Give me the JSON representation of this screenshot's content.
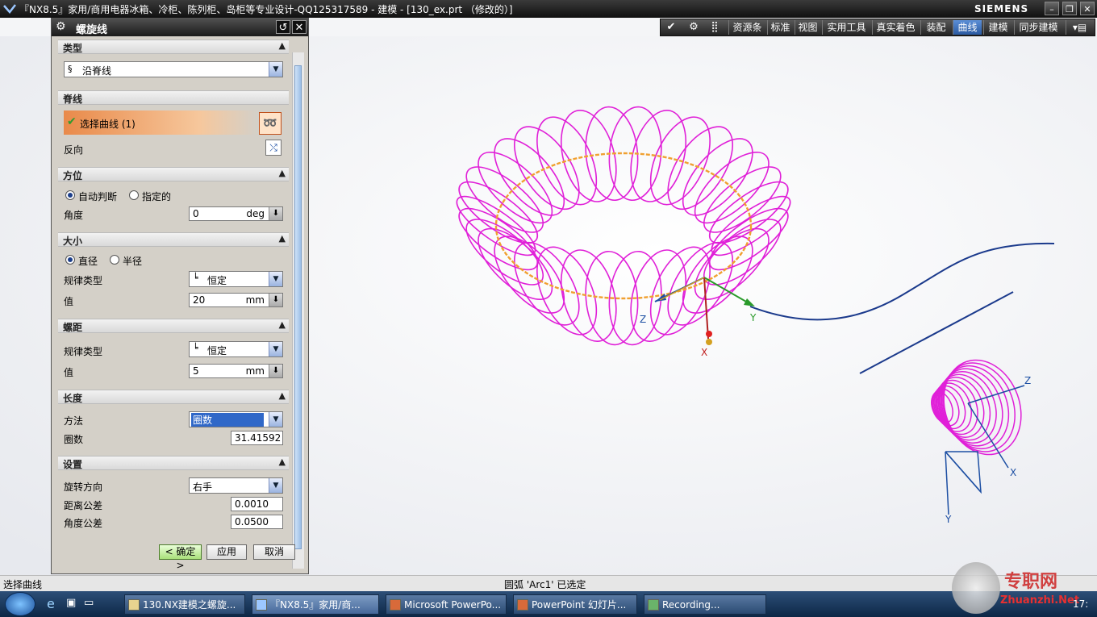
{
  "window": {
    "title": "『NX8.5』家用/商用电器冰箱、冷柜、陈列柜、岛柜等专业设计-QQ125317589 - 建模 - [130_ex.prt （修改的）]",
    "brand": "SIEMENS"
  },
  "toolbar": {
    "tabs": [
      "资源条",
      "标准",
      "视图",
      "实用工具",
      "真实着色",
      "装配",
      "曲线",
      "建模",
      "同步建模"
    ],
    "active_tab": "曲线"
  },
  "dialog": {
    "title": "螺旋线",
    "type": {
      "header": "类型",
      "value": "沿脊线"
    },
    "spine": {
      "header": "脊线",
      "select_label": "选择曲线 (1)",
      "reverse_label": "反向"
    },
    "orientation": {
      "header": "方位",
      "option_auto": "自动判断",
      "option_specified": "指定的",
      "angle_label": "角度",
      "angle_value": "0",
      "angle_unit": "deg"
    },
    "size": {
      "header": "大小",
      "option_diameter": "直径",
      "option_radius": "半径",
      "law_label": "规律类型",
      "law_value": "恒定",
      "value_label": "值",
      "value": "20",
      "unit": "mm"
    },
    "pitch": {
      "header": "螺距",
      "law_label": "规律类型",
      "law_value": "恒定",
      "value_label": "值",
      "value": "5",
      "unit": "mm"
    },
    "length": {
      "header": "长度",
      "method_label": "方法",
      "method_value": "圈数",
      "turns_label": "圈数",
      "turns_value": "31.41592"
    },
    "settings": {
      "header": "设置",
      "rotation_label": "旋转方向",
      "rotation_value": "右手",
      "dist_tol_label": "距离公差",
      "dist_tol_value": "0.0010",
      "angle_tol_label": "角度公差",
      "angle_tol_value": "0.0500"
    },
    "buttons": {
      "ok": "< 确定 >",
      "apply": "应用",
      "cancel": "取消"
    }
  },
  "viewport": {
    "triad_main": {
      "x": "X",
      "y": "Y",
      "z": "Z"
    },
    "triad_cone": {
      "x": "X",
      "y": "Y",
      "z": "Z"
    },
    "colors": {
      "helix": "#e020d8",
      "spine": "#f0a030",
      "curve": "#1b3a8c"
    }
  },
  "status": {
    "left": "选择曲线",
    "middle": "圆弧 'Arc1' 已选定"
  },
  "taskbar": {
    "tasks": [
      "130.NX建模之螺旋...",
      "『NX8.5』家用/商...",
      "Microsoft PowerPo...",
      "PowerPoint 幻灯片...",
      "Recording..."
    ],
    "clock": "17:",
    "watermark_cn": "专职网",
    "watermark_en": "Zhuanzhi.Net"
  }
}
